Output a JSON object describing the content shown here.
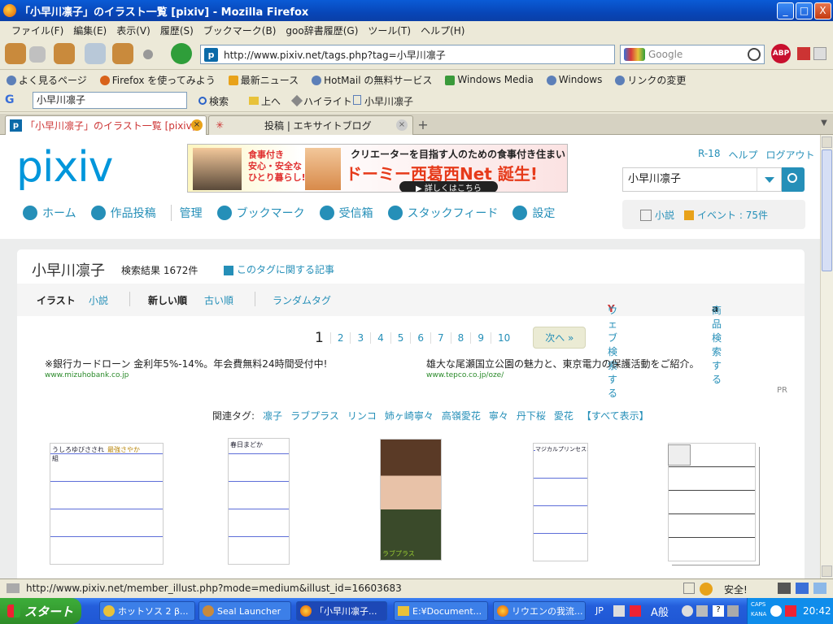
{
  "window": {
    "title": "「小早川凛子」のイラスト一覧 [pixiv] - Mozilla Firefox",
    "minimize": "_",
    "maximize": "□",
    "close": "X"
  },
  "menu": [
    "ファイル(F)",
    "編集(E)",
    "表示(V)",
    "履歴(S)",
    "ブックマーク(B)",
    "goo辞書履歴(G)",
    "ツール(T)",
    "ヘルプ(H)"
  ],
  "nav": {
    "url": "http://www.pixiv.net/tags.php?tag=小早川凛子",
    "search_placeholder": "Google",
    "abp_label": "ABP"
  },
  "bookmarks": [
    "よく見るページ",
    "Firefox を使ってみよう",
    "最新ニュース",
    "HotMail の無料サービス",
    "Windows Media",
    "Windows",
    "リンクの変更"
  ],
  "gbar": {
    "query": "小早川凛子",
    "search": "検索",
    "up": "上へ",
    "highlight": "ハイライト",
    "term": "小早川凛子"
  },
  "tabs": [
    {
      "label": "「小早川凛子」のイラスト一覧 [pixiv]"
    },
    {
      "label": "投稿 | エキサイトブログ"
    }
  ],
  "page": {
    "logo": "pixiv",
    "banner": {
      "line1": "食事付き",
      "line2": "安心・安全な",
      "line3": "ひとり暮らし!",
      "headline": "クリエーターを目指す人のための食事付き住まい",
      "main": "ドーミー西葛西Net 誕生!",
      "cta": "▶ 詳しくはこちら"
    },
    "toplinks": [
      "R-18",
      "ヘルプ",
      "ログアウト"
    ],
    "search_value": "小早川凛子",
    "nav": [
      "ホーム",
      "作品投稿",
      "管理",
      "ブックマーク",
      "受信箱",
      "スタックフィード",
      "設定"
    ],
    "side": {
      "novel": "小説",
      "event": "イベント : 75件"
    },
    "tag_title": "小早川凛子",
    "result_count": "検索結果 1672件",
    "article_link": "このタグに関する記事",
    "filters": {
      "illust": "イラスト",
      "novel": "小説",
      "newest": "新しい順",
      "oldest": "古い順",
      "random": "ランダムタグ",
      "web_search": "ウェブ検索する",
      "product_search": "商品検索する"
    },
    "pager": {
      "current": "1",
      "pages": [
        "2",
        "3",
        "4",
        "5",
        "6",
        "7",
        "8",
        "9",
        "10"
      ],
      "next": "次へ »"
    },
    "ads": [
      {
        "text": "※銀行カードローン 金利年5%-14%。年会費無料24時間受付中!",
        "url": "www.mizuhobank.co.jp"
      },
      {
        "text": "雄大な尾瀬国立公園の魅力と、東京電力の保護活動をご紹介。",
        "url": "www.tepco.co.jp/oze/"
      }
    ],
    "pr": "PR",
    "related_label": "関連タグ:",
    "related_tags": [
      "凛子",
      "ラブプラス",
      "リンコ",
      "姉ヶ崎寧々",
      "高嶺愛花",
      "寧々",
      "丹下桜",
      "愛花",
      "【すべて表示】"
    ],
    "thumb_captions": [
      "うしろゆびさされ組",
      "最強さやか",
      "春日まどか",
      "ラブプラス",
      "マジカルプリンセスホーリーアップ"
    ]
  },
  "status": {
    "url": "http://www.pixiv.net/member_illust.php?mode=medium&illust_id=16603683",
    "secure": "安全!"
  },
  "taskbar": {
    "start": "スタート",
    "items": [
      "ホットソス 2 β...",
      "Seal Launcher",
      "「小早川凛子...",
      "E:¥Document...",
      "リウエンの我流..."
    ],
    "ime": "JP",
    "ime2": "A般",
    "caps": "CAPS",
    "kana": "KANA",
    "clock": "20:42"
  }
}
